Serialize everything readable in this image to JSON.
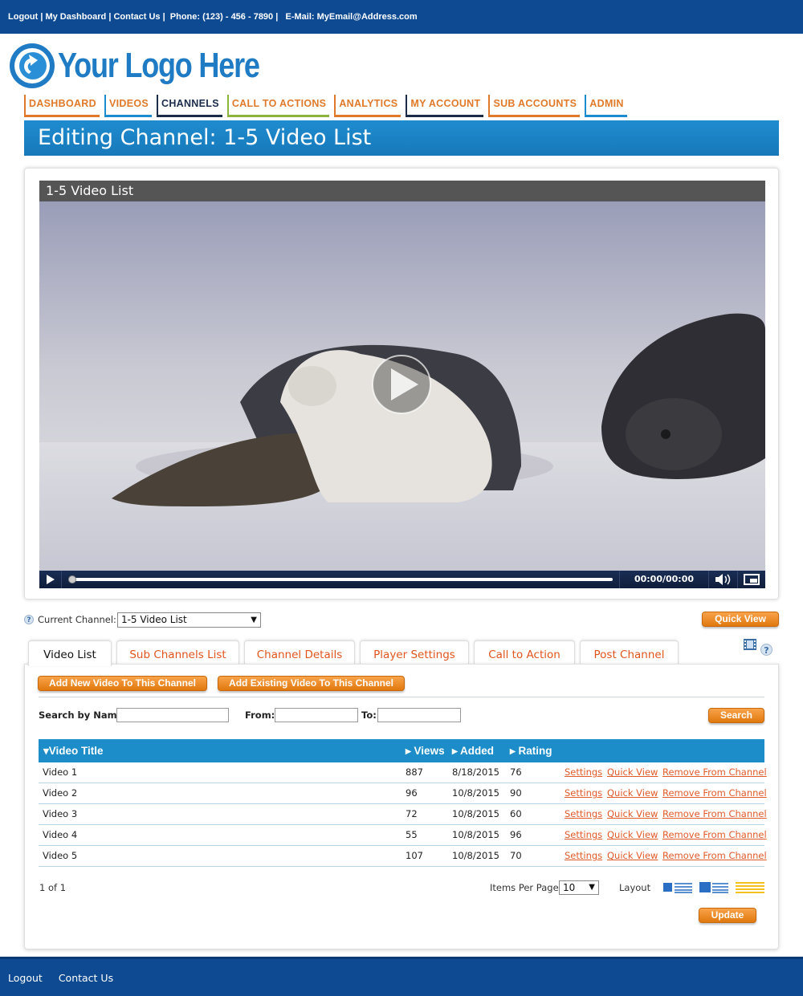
{
  "topbar": {
    "logout": "Logout",
    "sep1": " | ",
    "dashboard": "My Dashboard",
    "sep2": " | ",
    "contact": "Contact Us",
    "sep3": " |  ",
    "phone": "Phone: (123) - 456 - 7890",
    "sep4": " |   ",
    "email": "E-Mail: MyEmail@Address.com"
  },
  "logo": {
    "text": "Your Logo Here",
    "icon": "circular-arrow-logo-icon"
  },
  "nav": [
    {
      "label": "DASHBOARD",
      "color": "#e07a2a"
    },
    {
      "label": "VIDEOS",
      "color": "#1a8ccf"
    },
    {
      "label": "CHANNELS",
      "color": "#1a2c4a"
    },
    {
      "label": "CALL TO ACTIONS",
      "color": "#8cb43c"
    },
    {
      "label": "ANALYTICS",
      "color": "#e07a2a"
    },
    {
      "label": "MY ACCOUNT",
      "color": "#1a2c4a"
    },
    {
      "label": "SUB ACCOUNTS",
      "color": "#e07a2a"
    },
    {
      "label": "ADMIN",
      "color": "#1a8ccf"
    }
  ],
  "heading": "Editing Channel: 1-5 Video List",
  "player": {
    "title": "1-5 Video List",
    "time": "00:00/00:00",
    "progress": 0,
    "play_icon": "play-icon",
    "volume_icon": "volume-icon",
    "fullscreen_icon": "fullscreen-icon"
  },
  "current_channel": {
    "label": "Current Channel:",
    "value": "1-5 Video List",
    "arrow": "▼"
  },
  "quick_view_label": "Quick View",
  "tabs": [
    "Video List",
    "Sub Channels List",
    "Channel Details",
    "Player Settings",
    "Call to Action",
    "Post Channel"
  ],
  "tab_icons": {
    "film": "film-icon",
    "help": "?"
  },
  "help_glyph": "?",
  "actions": {
    "add_new": "Add New Video To This Channel",
    "add_existing": "Add Existing Video To This Channel"
  },
  "search": {
    "name_label": "Search by Name:",
    "from_label": "From:",
    "to_label": "To:",
    "button": "Search"
  },
  "table": {
    "headers": {
      "title": "Video Title",
      "views": "Views",
      "added": "Added",
      "rating": "Rating"
    },
    "sort_down": "▾",
    "sort_right": "▸",
    "rows": [
      {
        "title": "Video 1",
        "views": "887",
        "added": "8/18/2015",
        "rating": "76"
      },
      {
        "title": "Video 2",
        "views": "96",
        "added": "10/8/2015",
        "rating": "90"
      },
      {
        "title": "Video 3",
        "views": "72",
        "added": "10/8/2015",
        "rating": "60"
      },
      {
        "title": "Video 4",
        "views": "55",
        "added": "10/8/2015",
        "rating": "96"
      },
      {
        "title": "Video 5",
        "views": "107",
        "added": "10/8/2015",
        "rating": "70"
      }
    ],
    "links": {
      "settings": "Settings",
      "quick_view": "Quick View",
      "remove": "Remove From Channel"
    }
  },
  "pagination": {
    "pages": "1 of 1",
    "items_label": "Items Per Page",
    "items_value": "10",
    "layout_label": "Layout",
    "update": "Update"
  },
  "bottombar": {
    "logout": "Logout",
    "contact": "Contact Us"
  },
  "colors": {
    "brand_blue": "#0d4a92",
    "header_blue": "#1c8dc8",
    "accent_orange": "#e07a2a",
    "link_red": "#e05a2a"
  }
}
